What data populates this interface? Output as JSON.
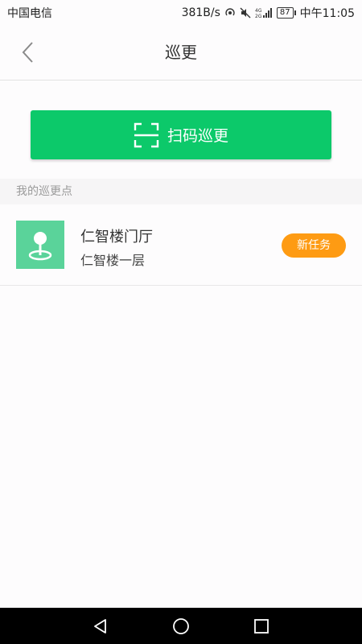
{
  "status_bar": {
    "carrier": "中国电信",
    "network_speed": "381B/s",
    "signal_label": "4G 2G",
    "battery": "87",
    "time": "中午11:05"
  },
  "header": {
    "title": "巡更"
  },
  "scan": {
    "label": "扫码巡更",
    "color": "#0cc96a"
  },
  "section": {
    "title": "我的巡更点"
  },
  "patrol_points": [
    {
      "name": "仁智楼门厅",
      "location": "仁智楼一层",
      "badge": "新任务",
      "badge_color": "#fe9b13",
      "icon": "map-pin-icon"
    }
  ]
}
